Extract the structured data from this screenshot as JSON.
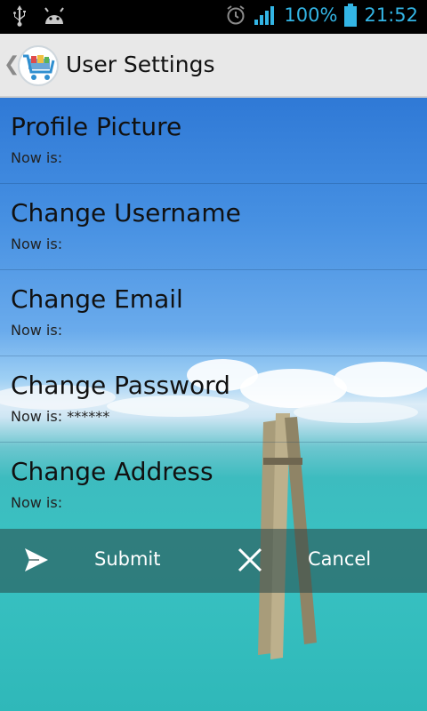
{
  "status_bar": {
    "battery": "100%",
    "time": "21:52",
    "icons": [
      "usb-icon",
      "android-icon",
      "alarm-icon",
      "signal-icon",
      "battery-icon"
    ]
  },
  "action_bar": {
    "title": "User Settings",
    "icon": "shopping-cart-app-icon"
  },
  "settings": [
    {
      "title": "Profile Picture",
      "value": "Now is:"
    },
    {
      "title": "Change Username",
      "value": "Now is:"
    },
    {
      "title": "Change Email",
      "value": "Now is:"
    },
    {
      "title": "Change Password",
      "value": "Now is: ******"
    },
    {
      "title": "Change Address",
      "value": "Now is:"
    }
  ],
  "actions": {
    "submit": "Submit",
    "cancel": "Cancel"
  },
  "colors": {
    "status_icons": "#33b5e5",
    "action_bar_bg": "#e8e8e8"
  }
}
